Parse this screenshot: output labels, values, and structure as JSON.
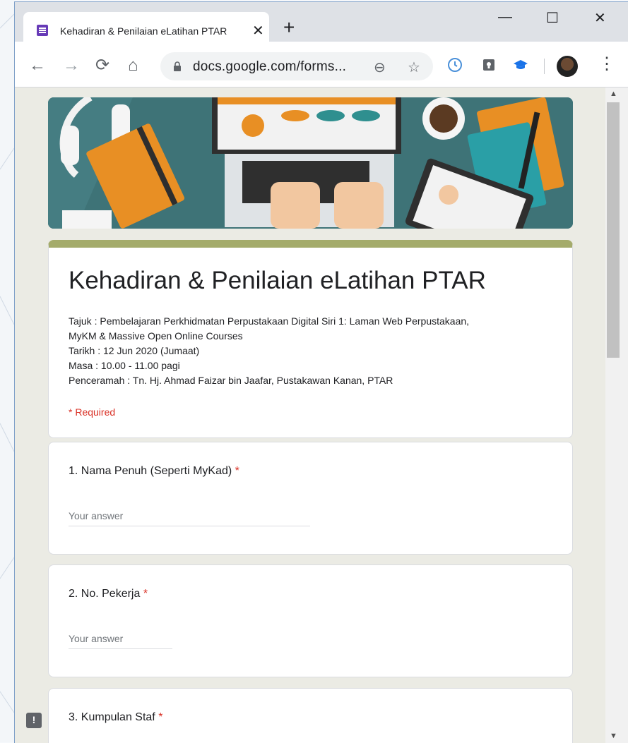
{
  "browser": {
    "tab_title": "Kehadiran & Penilaian eLatihan PTAR",
    "tab_close": "✕",
    "new_tab": "+",
    "url": "docs.google.com/forms...",
    "window_controls": {
      "minimize": "—",
      "maximize": "☐",
      "close": "✕"
    },
    "nav": {
      "back": "←",
      "forward": "→",
      "reload": "⟳",
      "home": "⌂"
    },
    "omnibox_icons": {
      "zoom": "⊖",
      "bookmark": "☆"
    },
    "menu": "⋮"
  },
  "form": {
    "title": "Kehadiran & Penilaian eLatihan PTAR",
    "description": [
      "Tajuk : Pembelajaran Perkhidmatan Perpustakaan Digital Siri 1: Laman Web Perpustakaan,",
      "MyKM & Massive Open Online Courses",
      "Tarikh : 12 Jun 2020 (Jumaat)",
      "Masa : 10.00 - 11.00 pagi",
      "Penceramah : Tn. Hj. Ahmad Faizar bin Jaafar, Pustakawan Kanan, PTAR"
    ],
    "required_note": "* Required",
    "questions": [
      {
        "label": "1. Nama Penuh (Seperti MyKad)",
        "required_mark": "*",
        "placeholder": "Your answer"
      },
      {
        "label": "2. No. Pekerja",
        "required_mark": "*",
        "placeholder": "Your answer"
      },
      {
        "label": "3. Kumpulan Staf",
        "required_mark": "*"
      }
    ],
    "feedback_icon": "!"
  },
  "colors": {
    "accent_bar": "#a4ab6b",
    "required": "#d93025",
    "forms_icon": "#673ab7"
  }
}
